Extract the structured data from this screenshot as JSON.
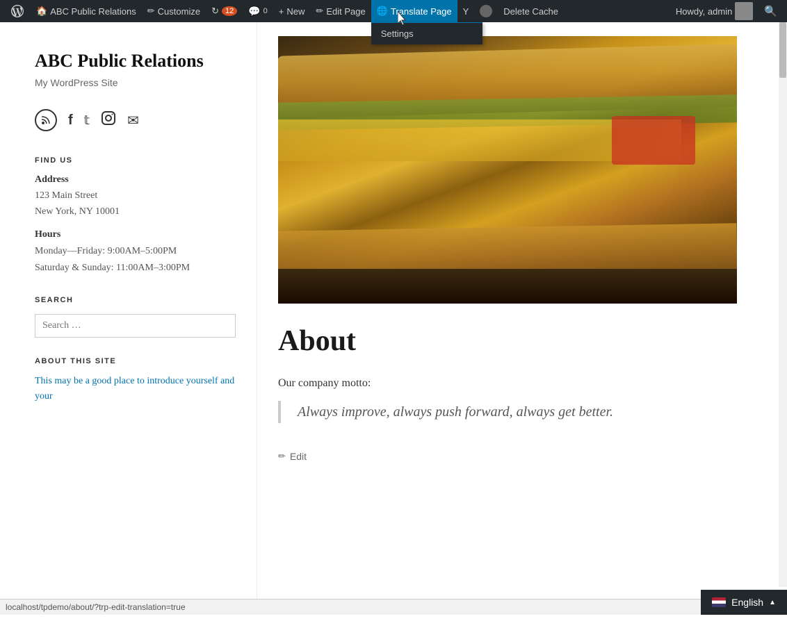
{
  "adminBar": {
    "wpLogoLabel": "WordPress",
    "siteTitle": "ABC Public Relations",
    "customizeLabel": "Customize",
    "updatesCount": "12",
    "commentsCount": "0",
    "newLabel": "New",
    "editPageLabel": "Edit Page",
    "translatePageLabel": "Translate Page",
    "yoastLabel": "Yoast",
    "userCircleLabel": "",
    "deleteCacheLabel": "Delete Cache",
    "howdyLabel": "Howdy, admin",
    "searchLabel": "Search",
    "settingsLabel": "Settings"
  },
  "sidebar": {
    "siteTitle": "ABC Public Relations",
    "siteTagline": "My WordPress Site",
    "socialIcons": [
      {
        "name": "rss-icon",
        "symbol": "⟳"
      },
      {
        "name": "facebook-icon",
        "symbol": "f"
      },
      {
        "name": "twitter-icon",
        "symbol": "t"
      },
      {
        "name": "instagram-icon",
        "symbol": "◎"
      },
      {
        "name": "email-icon",
        "symbol": "✉"
      }
    ],
    "findUsTitle": "FIND US",
    "addressLabel": "Address",
    "addressLine1": "123 Main Street",
    "addressLine2": "New York, NY 10001",
    "hoursLabel": "Hours",
    "hoursWeekdays": "Monday—Friday: 9:00AM–5:00PM",
    "hoursSaturday": "Saturday & Sunday: 11:00AM–3:00PM",
    "searchTitle": "SEARCH",
    "searchPlaceholder": "Search …",
    "aboutSiteTitle": "ABOUT THIS SITE",
    "aboutText": "This may be a good place to introduce yourself and your"
  },
  "main": {
    "pageTitle": "About",
    "mottoLabel": "Our company motto:",
    "quoteText": "Always improve, always push forward, always get better.",
    "editLinkLabel": "Edit"
  },
  "footer": {
    "statusBarUrl": "localhost/tpdemo/about/?trp-edit-translation=true",
    "englishLabel": "English"
  }
}
